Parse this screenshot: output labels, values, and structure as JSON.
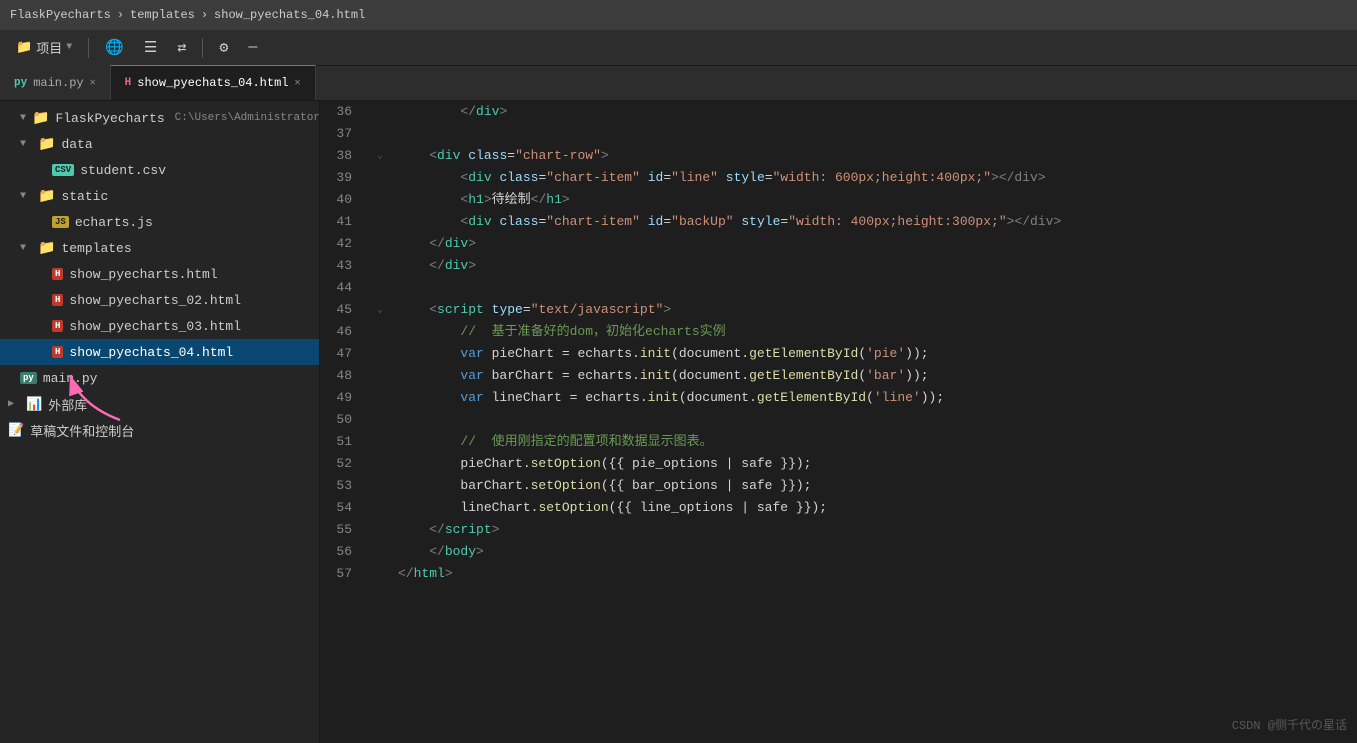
{
  "titlebar": {
    "project": "FlaskPyecharts",
    "sep1": "›",
    "folder": "templates",
    "sep2": "›",
    "file": "show_pyechats_04.html"
  },
  "menubar": {
    "project_label": "项目",
    "icons": [
      "add-icon",
      "list-icon",
      "split-icon",
      "settings-icon",
      "minimize-icon"
    ]
  },
  "tabs": [
    {
      "id": "tab-main-py",
      "label": "main.py",
      "type": "py",
      "active": false,
      "closable": true
    },
    {
      "id": "tab-show-html",
      "label": "show_pyechats_04.html",
      "type": "html",
      "active": true,
      "closable": true
    }
  ],
  "sidebar": {
    "project_name": "FlaskPyecharts",
    "project_path": "C:\\Users\\Administrator\\",
    "items": [
      {
        "id": "folder-data",
        "label": "data",
        "type": "folder",
        "indent": 1,
        "expanded": true
      },
      {
        "id": "file-student-csv",
        "label": "student.csv",
        "type": "csv",
        "indent": 2
      },
      {
        "id": "folder-static",
        "label": "static",
        "type": "folder",
        "indent": 1,
        "expanded": true
      },
      {
        "id": "file-echarts-js",
        "label": "echarts.js",
        "type": "js",
        "indent": 2
      },
      {
        "id": "folder-templates",
        "label": "templates",
        "type": "folder",
        "indent": 1,
        "expanded": true
      },
      {
        "id": "file-show-01",
        "label": "show_pyecharts.html",
        "type": "html",
        "indent": 2
      },
      {
        "id": "file-show-02",
        "label": "show_pyecharts_02.html",
        "type": "html",
        "indent": 2
      },
      {
        "id": "file-show-03",
        "label": "show_pyecharts_03.html",
        "type": "html",
        "indent": 2
      },
      {
        "id": "file-show-04",
        "label": "show_pyechats_04.html",
        "type": "html",
        "indent": 2,
        "selected": true
      },
      {
        "id": "file-main-py",
        "label": "main.py",
        "type": "py",
        "indent": 1
      },
      {
        "id": "external-libs",
        "label": "外部库",
        "type": "external",
        "indent": 0
      },
      {
        "id": "draft-console",
        "label": "草稿文件和控制台",
        "type": "draft",
        "indent": 0
      }
    ]
  },
  "code": {
    "lines": [
      {
        "num": 36,
        "indent_marker": false,
        "content": [
          {
            "t": "plain",
            "v": "        </div>"
          }
        ]
      },
      {
        "num": 37,
        "indent_marker": false,
        "content": []
      },
      {
        "num": 38,
        "indent_marker": true,
        "content": [
          {
            "t": "plain",
            "v": "    "
          },
          {
            "t": "lt",
            "v": "<"
          },
          {
            "t": "tag",
            "v": "div"
          },
          {
            "t": "plain",
            "v": " "
          },
          {
            "t": "attr",
            "v": "class"
          },
          {
            "t": "plain",
            "v": "="
          },
          {
            "t": "str",
            "v": "\"chart-row\""
          },
          {
            "t": "lt",
            "v": ">"
          }
        ]
      },
      {
        "num": 39,
        "indent_marker": false,
        "content": [
          {
            "t": "plain",
            "v": "        "
          },
          {
            "t": "lt",
            "v": "<"
          },
          {
            "t": "tag",
            "v": "div"
          },
          {
            "t": "plain",
            "v": " "
          },
          {
            "t": "attr",
            "v": "class"
          },
          {
            "t": "plain",
            "v": "="
          },
          {
            "t": "str",
            "v": "\"chart-item\""
          },
          {
            "t": "plain",
            "v": " "
          },
          {
            "t": "attr",
            "v": "id"
          },
          {
            "t": "plain",
            "v": "="
          },
          {
            "t": "str",
            "v": "\"line\""
          },
          {
            "t": "plain",
            "v": " "
          },
          {
            "t": "attr",
            "v": "style"
          },
          {
            "t": "plain",
            "v": "="
          },
          {
            "t": "str",
            "v": "\"width: 600px;height:400px;\""
          },
          {
            "t": "lt",
            "v": "></div>"
          }
        ]
      },
      {
        "num": 40,
        "indent_marker": false,
        "content": [
          {
            "t": "plain",
            "v": "        "
          },
          {
            "t": "lt",
            "v": "<"
          },
          {
            "t": "tag",
            "v": "h1"
          },
          {
            "t": "lt",
            "v": ">"
          },
          {
            "t": "plain",
            "v": "待绘制"
          },
          {
            "t": "lt",
            "v": "</"
          },
          {
            "t": "tag",
            "v": "h1"
          },
          {
            "t": "lt",
            "v": ">"
          }
        ]
      },
      {
        "num": 41,
        "indent_marker": false,
        "content": [
          {
            "t": "plain",
            "v": "        "
          },
          {
            "t": "lt",
            "v": "<"
          },
          {
            "t": "tag",
            "v": "div"
          },
          {
            "t": "plain",
            "v": " "
          },
          {
            "t": "attr",
            "v": "class"
          },
          {
            "t": "plain",
            "v": "="
          },
          {
            "t": "str",
            "v": "\"chart-item\""
          },
          {
            "t": "plain",
            "v": " "
          },
          {
            "t": "attr",
            "v": "id"
          },
          {
            "t": "plain",
            "v": "="
          },
          {
            "t": "str",
            "v": "\"backUp\""
          },
          {
            "t": "plain",
            "v": " "
          },
          {
            "t": "attr",
            "v": "style"
          },
          {
            "t": "plain",
            "v": "="
          },
          {
            "t": "str",
            "v": "\"width: 400px;height:300px;\""
          },
          {
            "t": "lt",
            "v": "></div>"
          }
        ]
      },
      {
        "num": 42,
        "indent_marker": false,
        "content": [
          {
            "t": "plain",
            "v": "    "
          },
          {
            "t": "lt",
            "v": "</"
          },
          {
            "t": "tag",
            "v": "div"
          },
          {
            "t": "lt",
            "v": ">"
          }
        ]
      },
      {
        "num": 43,
        "indent_marker": false,
        "content": [
          {
            "t": "plain",
            "v": "    "
          },
          {
            "t": "lt",
            "v": "</"
          },
          {
            "t": "tag",
            "v": "div"
          },
          {
            "t": "lt",
            "v": ">"
          }
        ]
      },
      {
        "num": 44,
        "indent_marker": false,
        "content": []
      },
      {
        "num": 45,
        "indent_marker": true,
        "content": [
          {
            "t": "plain",
            "v": "    "
          },
          {
            "t": "lt",
            "v": "<"
          },
          {
            "t": "tag",
            "v": "script"
          },
          {
            "t": "plain",
            "v": " "
          },
          {
            "t": "attr",
            "v": "type"
          },
          {
            "t": "plain",
            "v": "="
          },
          {
            "t": "str",
            "v": "\"text/javascript\""
          },
          {
            "t": "lt",
            "v": ">"
          }
        ]
      },
      {
        "num": 46,
        "indent_marker": false,
        "content": [
          {
            "t": "plain",
            "v": "        "
          },
          {
            "t": "cm",
            "v": "//  基于准备好的dom，初始化echarts实例"
          }
        ]
      },
      {
        "num": 47,
        "indent_marker": false,
        "content": [
          {
            "t": "plain",
            "v": "        "
          },
          {
            "t": "kw",
            "v": "var"
          },
          {
            "t": "plain",
            "v": " pieChart = echarts."
          },
          {
            "t": "fn",
            "v": "init"
          },
          {
            "t": "plain",
            "v": "(document."
          },
          {
            "t": "fn",
            "v": "getElementById"
          },
          {
            "t": "plain",
            "v": "("
          },
          {
            "t": "str",
            "v": "'pie'"
          },
          {
            "t": "plain",
            "v": "));"
          }
        ]
      },
      {
        "num": 48,
        "indent_marker": false,
        "content": [
          {
            "t": "plain",
            "v": "        "
          },
          {
            "t": "kw",
            "v": "var"
          },
          {
            "t": "plain",
            "v": " barChart = echarts."
          },
          {
            "t": "fn",
            "v": "init"
          },
          {
            "t": "plain",
            "v": "(document."
          },
          {
            "t": "fn",
            "v": "getElementById"
          },
          {
            "t": "plain",
            "v": "("
          },
          {
            "t": "str",
            "v": "'bar'"
          },
          {
            "t": "plain",
            "v": "));"
          }
        ]
      },
      {
        "num": 49,
        "indent_marker": false,
        "content": [
          {
            "t": "plain",
            "v": "        "
          },
          {
            "t": "kw",
            "v": "var"
          },
          {
            "t": "plain",
            "v": " lineChart = echarts."
          },
          {
            "t": "fn",
            "v": "init"
          },
          {
            "t": "plain",
            "v": "(document."
          },
          {
            "t": "fn",
            "v": "getElementById"
          },
          {
            "t": "plain",
            "v": "("
          },
          {
            "t": "str",
            "v": "'line'"
          },
          {
            "t": "plain",
            "v": "));"
          }
        ]
      },
      {
        "num": 50,
        "indent_marker": false,
        "content": []
      },
      {
        "num": 51,
        "indent_marker": false,
        "content": [
          {
            "t": "plain",
            "v": "        "
          },
          {
            "t": "cm",
            "v": "//  使用刚指定的配置项和数据显示图表。"
          }
        ]
      },
      {
        "num": 52,
        "indent_marker": false,
        "content": [
          {
            "t": "plain",
            "v": "        pieChart."
          },
          {
            "t": "fn",
            "v": "setOption"
          },
          {
            "t": "plain",
            "v": "({ pie_options | safe }});"
          }
        ]
      },
      {
        "num": 53,
        "indent_marker": false,
        "content": [
          {
            "t": "plain",
            "v": "        barChart."
          },
          {
            "t": "fn",
            "v": "setOption"
          },
          {
            "t": "plain",
            "v": "({ bar_options | safe }});"
          }
        ]
      },
      {
        "num": 54,
        "indent_marker": false,
        "content": [
          {
            "t": "plain",
            "v": "        lineChart."
          },
          {
            "t": "fn",
            "v": "setOption"
          },
          {
            "t": "plain",
            "v": "({ line_options | safe }});"
          }
        ]
      },
      {
        "num": 55,
        "indent_marker": false,
        "content": [
          {
            "t": "plain",
            "v": "    "
          },
          {
            "t": "lt",
            "v": "</"
          },
          {
            "t": "tag",
            "v": "script"
          },
          {
            "t": "lt",
            "v": ">"
          }
        ]
      },
      {
        "num": 56,
        "indent_marker": false,
        "content": [
          {
            "t": "plain",
            "v": "    "
          },
          {
            "t": "lt",
            "v": "</"
          },
          {
            "t": "tag",
            "v": "body"
          },
          {
            "t": "lt",
            "v": ">"
          }
        ]
      },
      {
        "num": 57,
        "indent_marker": false,
        "content": [
          {
            "t": "lt",
            "v": "</"
          },
          {
            "t": "tag",
            "v": "html"
          },
          {
            "t": "lt",
            "v": ">"
          }
        ]
      }
    ]
  },
  "watermark": "CSDN @侧千代の星话"
}
